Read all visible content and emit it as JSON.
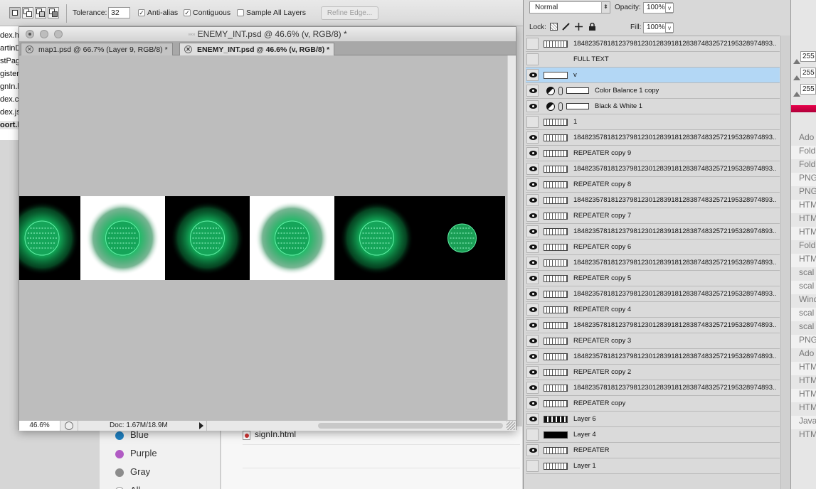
{
  "options_bar": {
    "tolerance_label": "Tolerance:",
    "tolerance_value": "32",
    "anti_alias_label": "Anti-alias",
    "anti_alias_checked": true,
    "contiguous_label": "Contiguous",
    "contiguous_checked": true,
    "sample_all_label": "Sample All Layers",
    "sample_all_checked": false,
    "refine_edge_label": "Refine Edge..."
  },
  "background_files": [
    "dex.htm",
    "artinD",
    "stPag",
    "gister.",
    "gnIn.h",
    "dex.cs",
    "dex.js",
    "oort.h"
  ],
  "document": {
    "title": "ENEMY_INT.psd @ 46.6% (v, RGB/8) *",
    "title_prefix": "▫▫▫▫",
    "tabs": [
      {
        "label": "map1.psd @ 66.7% (Layer 9, RGB/8) *",
        "active": false
      },
      {
        "label": "ENEMY_INT.psd @ 46.6% (v, RGB/8) *",
        "active": true
      }
    ],
    "zoom": "46.6%",
    "doc_info": "Doc: 1.67M/18.9M",
    "frames": [
      "black",
      "white",
      "black",
      "white",
      "black",
      "black"
    ]
  },
  "finder": {
    "tags": [
      {
        "label": "Blue",
        "color": "#1f7fbf"
      },
      {
        "label": "Purple",
        "color": "#b15bc4"
      },
      {
        "label": "Gray",
        "color": "#8c8c8c"
      },
      {
        "label": "All T",
        "color": "#ffffff"
      }
    ],
    "file": "signIn.html"
  },
  "layers_panel": {
    "blend_mode": "Normal",
    "opacity_label": "Opacity:",
    "opacity_value": "100%",
    "lock_label": "Lock:",
    "fill_label": "Fill:",
    "fill_value": "100%",
    "layers": [
      {
        "name": "18482357818123798123012839181283874832572195328974893...",
        "visible": false,
        "thumb": "dotted",
        "selected": false,
        "adjustment": false
      },
      {
        "name": "FULL TEXT",
        "visible": false,
        "thumb": "none",
        "selected": false,
        "adjustment": false
      },
      {
        "name": "v",
        "visible": true,
        "thumb": "plain",
        "selected": true,
        "adjustment": false
      },
      {
        "name": "Color Balance 1 copy",
        "visible": true,
        "thumb": "adjust",
        "selected": false,
        "adjustment": true
      },
      {
        "name": "Black & White 1",
        "visible": true,
        "thumb": "adjust",
        "selected": false,
        "adjustment": true
      },
      {
        "name": "1",
        "visible": false,
        "thumb": "dotted",
        "selected": false,
        "adjustment": false
      },
      {
        "name": "18482357818123798123012839181283874832572195328974893...",
        "visible": true,
        "thumb": "dotted",
        "selected": false,
        "adjustment": false
      },
      {
        "name": "REPEATER copy 9",
        "visible": true,
        "thumb": "dotted",
        "selected": false,
        "adjustment": false
      },
      {
        "name": "18482357818123798123012839181283874832572195328974893...",
        "visible": true,
        "thumb": "dotted",
        "selected": false,
        "adjustment": false
      },
      {
        "name": "REPEATER copy 8",
        "visible": true,
        "thumb": "dotted",
        "selected": false,
        "adjustment": false
      },
      {
        "name": "18482357818123798123012839181283874832572195328974893...",
        "visible": true,
        "thumb": "dotted",
        "selected": false,
        "adjustment": false
      },
      {
        "name": "REPEATER copy 7",
        "visible": true,
        "thumb": "dotted",
        "selected": false,
        "adjustment": false
      },
      {
        "name": "18482357818123798123012839181283874832572195328974893...",
        "visible": true,
        "thumb": "dotted",
        "selected": false,
        "adjustment": false
      },
      {
        "name": "REPEATER copy 6",
        "visible": true,
        "thumb": "dotted",
        "selected": false,
        "adjustment": false
      },
      {
        "name": "18482357818123798123012839181283874832572195328974893...",
        "visible": true,
        "thumb": "dotted",
        "selected": false,
        "adjustment": false
      },
      {
        "name": "REPEATER copy 5",
        "visible": true,
        "thumb": "dotted",
        "selected": false,
        "adjustment": false
      },
      {
        "name": "18482357818123798123012839181283874832572195328974893...",
        "visible": true,
        "thumb": "dotted",
        "selected": false,
        "adjustment": false
      },
      {
        "name": "REPEATER copy 4",
        "visible": true,
        "thumb": "dotted",
        "selected": false,
        "adjustment": false
      },
      {
        "name": "18482357818123798123012839181283874832572195328974893...",
        "visible": true,
        "thumb": "dotted",
        "selected": false,
        "adjustment": false
      },
      {
        "name": "REPEATER copy 3",
        "visible": true,
        "thumb": "dotted",
        "selected": false,
        "adjustment": false
      },
      {
        "name": "18482357818123798123012839181283874832572195328974893...",
        "visible": true,
        "thumb": "dotted",
        "selected": false,
        "adjustment": false
      },
      {
        "name": "REPEATER copy 2",
        "visible": true,
        "thumb": "dotted",
        "selected": false,
        "adjustment": false
      },
      {
        "name": "18482357818123798123012839181283874832572195328974893...",
        "visible": true,
        "thumb": "dotted",
        "selected": false,
        "adjustment": false
      },
      {
        "name": "REPEATER copy",
        "visible": true,
        "thumb": "dotted",
        "selected": false,
        "adjustment": false
      },
      {
        "name": "Layer 6",
        "visible": true,
        "thumb": "blocks",
        "selected": false,
        "adjustment": false
      },
      {
        "name": "Layer 4",
        "visible": false,
        "thumb": "solid",
        "selected": false,
        "adjustment": false
      },
      {
        "name": "REPEATER",
        "visible": true,
        "thumb": "dotted",
        "selected": false,
        "adjustment": false
      },
      {
        "name": "Layer 1",
        "visible": false,
        "thumb": "dotted",
        "selected": false,
        "adjustment": false
      }
    ]
  },
  "right_edge": {
    "rgb_values": [
      "255",
      "255",
      "255"
    ],
    "list": [
      "Ado",
      "Fold",
      "Fold",
      "PNG",
      "PNG",
      "HTM",
      "HTM",
      "HTM",
      "Fold",
      "HTM",
      "scal",
      "scal",
      "Wind",
      "scal",
      "scal",
      "PNG",
      "Ado",
      "HTM",
      "HTM",
      "HTM",
      "HTM",
      "Java",
      "HTM"
    ]
  }
}
